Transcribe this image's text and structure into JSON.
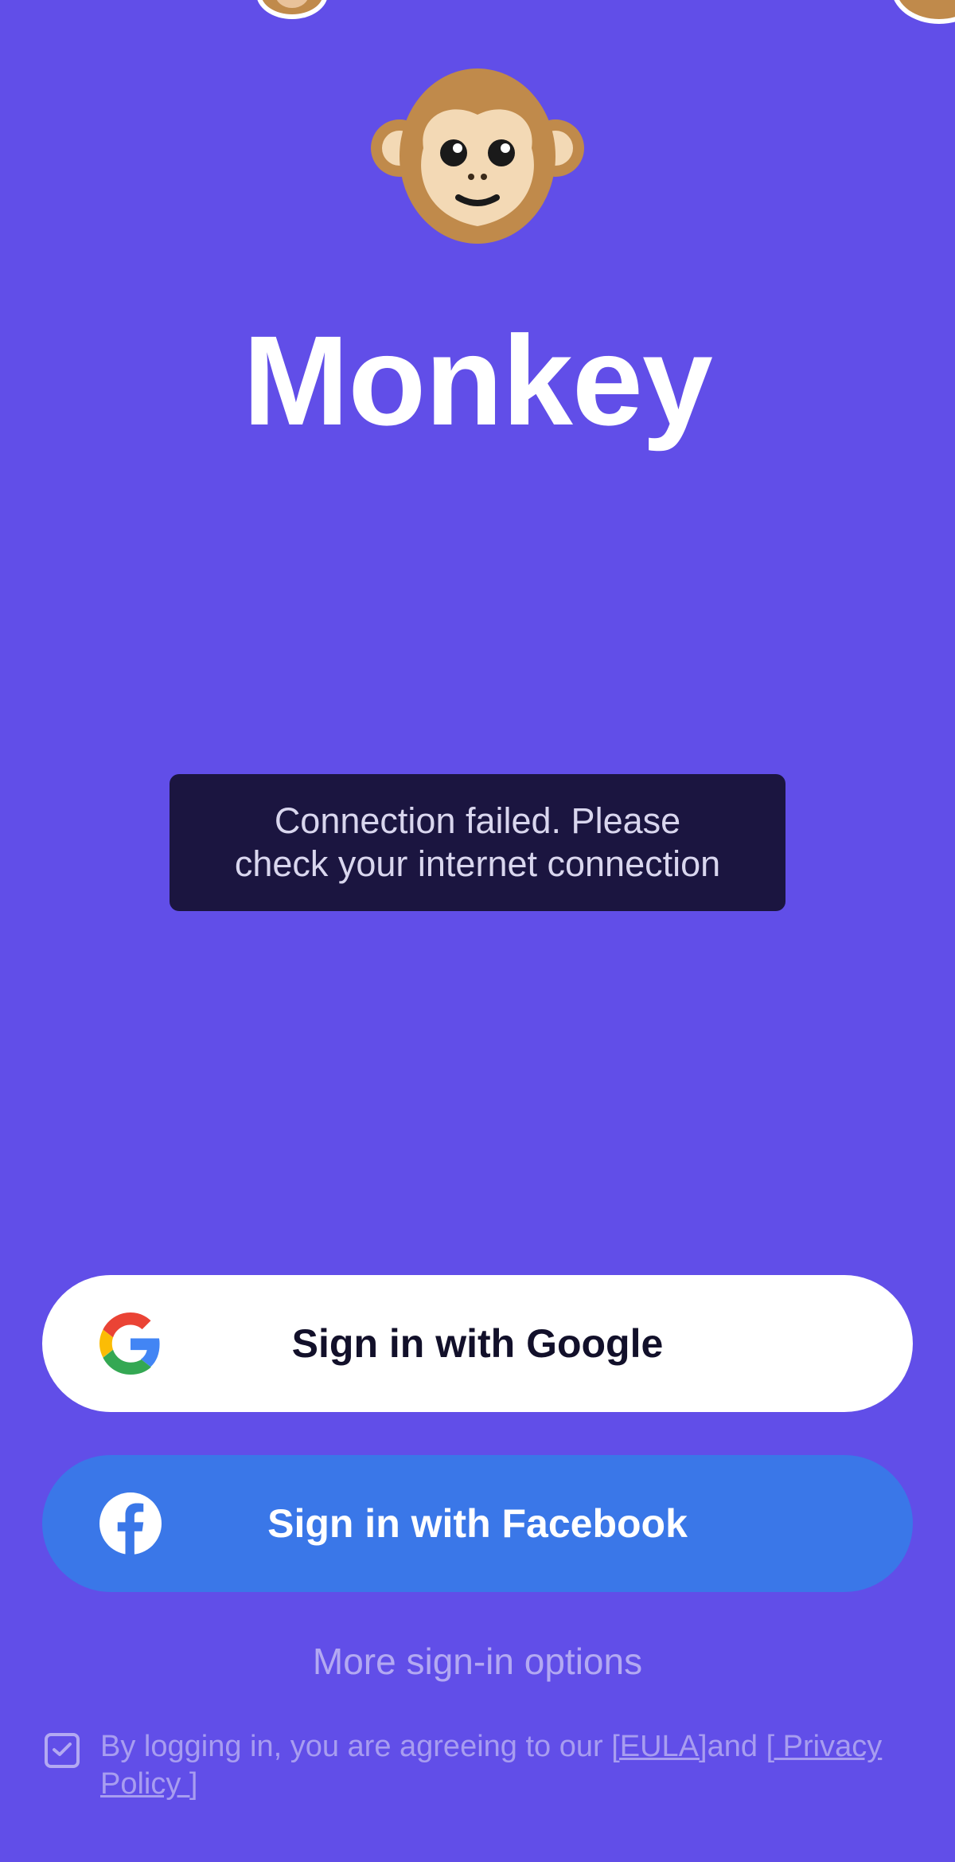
{
  "app": {
    "title": "Monkey",
    "logo_icon": "monkey-face-icon",
    "colors": {
      "background": "#614EE8",
      "toast_background": "#1B1540",
      "google_button": "#ffffff",
      "facebook_button": "#3A77E8"
    }
  },
  "toast": {
    "line1": "Connection failed. Please",
    "line2": "check your internet connection"
  },
  "buttons": {
    "google": {
      "label": "Sign in with Google",
      "icon": "google-logo-icon"
    },
    "facebook": {
      "label": "Sign in with Facebook",
      "icon": "facebook-logo-icon"
    }
  },
  "more_options": {
    "label": "More sign-in options"
  },
  "consent": {
    "checked": true,
    "prefix": "By logging in, you are agreeing to our ",
    "eula_label": "[EULA]",
    "middle": "and ",
    "privacy_label": "[ Privacy Policy ]"
  }
}
